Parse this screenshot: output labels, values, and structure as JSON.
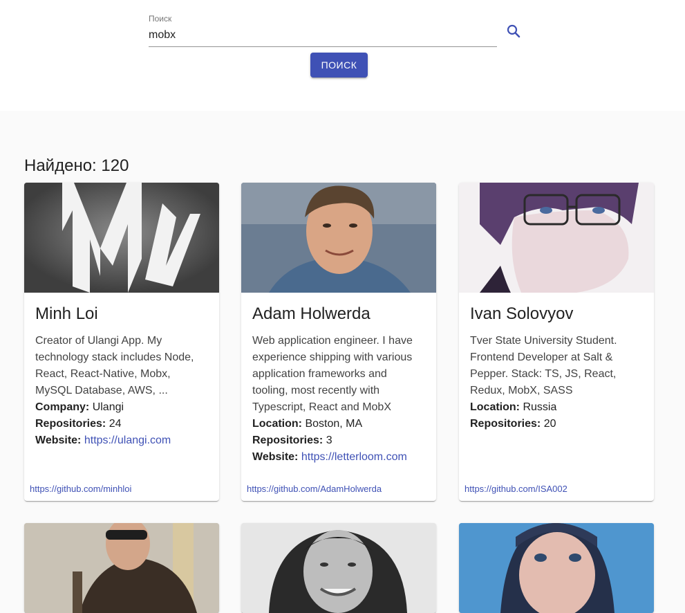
{
  "search": {
    "label": "Поиск",
    "value": "mobx",
    "button_label": "ПОИСК",
    "icon": "search-icon"
  },
  "results": {
    "prefix": "Найдено:",
    "count": "120"
  },
  "cards": [
    {
      "name": "Minh Loi",
      "bio": "Creator of Ulangi App. My technology stack includes Node, React, React-Native, Mobx, MySQL Database, AWS, ...",
      "lines": [
        {
          "label": "Company:",
          "value": "Ulangi"
        },
        {
          "label": "Repositories:",
          "value": "24"
        },
        {
          "label": "Website:",
          "value": "https://ulangi.com",
          "link": true
        }
      ],
      "github": "https://github.com/minhloi"
    },
    {
      "name": "Adam Holwerda",
      "bio": "Web application engineer. I have experience shipping with various application frameworks and tooling, most recently with Typescript, React and MobX",
      "lines": [
        {
          "label": "Location:",
          "value": "Boston, MA"
        },
        {
          "label": "Repositories:",
          "value": "3"
        },
        {
          "label": "Website:",
          "value": "https://letterloom.com",
          "link": true
        }
      ],
      "github": "https://github.com/AdamHolwerda"
    },
    {
      "name": "Ivan Solovyov",
      "bio": "Tver State University Student. Frontend Developer at Salt & Pepper. Stack: TS, JS, React, Redux, MobX, SASS",
      "lines": [
        {
          "label": "Location:",
          "value": "Russia"
        },
        {
          "label": "Repositories:",
          "value": "20"
        }
      ],
      "github": "https://github.com/ISA002"
    }
  ],
  "colors": {
    "accent": "#3f51b5",
    "background": "#fafafa"
  }
}
